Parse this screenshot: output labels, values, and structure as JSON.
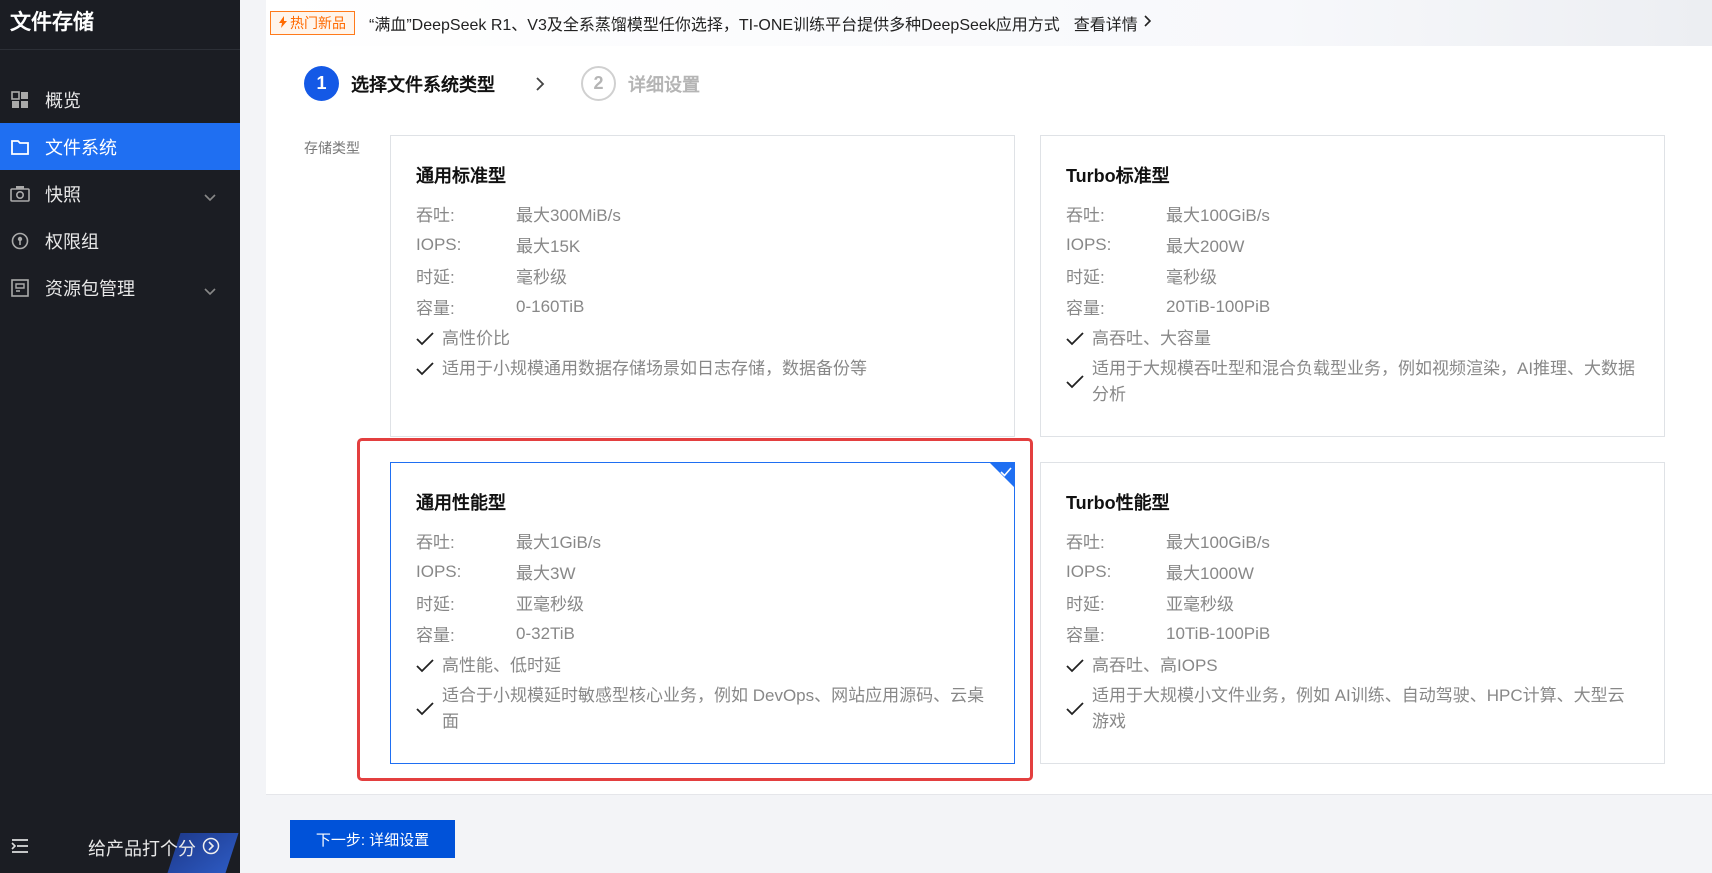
{
  "sidebar": {
    "title": "文件存储",
    "items": [
      {
        "label": "概览",
        "icon": "grid-icon"
      },
      {
        "label": "文件系统",
        "icon": "folder-icon",
        "active": true
      },
      {
        "label": "快照",
        "icon": "camera-icon",
        "expandable": true
      },
      {
        "label": "权限组",
        "icon": "permission-icon"
      },
      {
        "label": "资源包管理",
        "icon": "package-icon",
        "expandable": true
      }
    ],
    "feedback_label": "给产品打个分"
  },
  "announcement": {
    "badge": "热门新品",
    "text": "“满血”DeepSeek R1、V3及全系蒸馏模型任你选择，TI-ONE训练平台提供多种DeepSeek应用方式",
    "link": "查看详情"
  },
  "steps": [
    {
      "num": "1",
      "label": "选择文件系统类型",
      "active": true
    },
    {
      "num": "2",
      "label": "详细设置",
      "active": false
    }
  ],
  "storage_type_label": "存储类型",
  "spec_labels": {
    "throughput": "吞吐:",
    "iops": "IOPS:",
    "latency": "时延:",
    "capacity": "容量:"
  },
  "cards": [
    {
      "title": "通用标准型",
      "throughput": "最大300MiB/s",
      "iops": "最大15K",
      "latency": "毫秒级",
      "capacity": "0-160TiB",
      "features": [
        "高性价比",
        "适用于小规模通用数据存储场景如日志存储，数据备份等"
      ],
      "selected": false
    },
    {
      "title": "Turbo标准型",
      "throughput": "最大100GiB/s",
      "iops": "最大200W",
      "latency": "毫秒级",
      "capacity": "20TiB-100PiB",
      "features": [
        "高吞吐、大容量",
        "适用于大规模吞吐型和混合负载型业务，例如视频渲染，AI推理、大数据分析"
      ],
      "selected": false
    },
    {
      "title": "通用性能型",
      "throughput": "最大1GiB/s",
      "iops": "最大3W",
      "latency": "亚毫秒级",
      "capacity": "0-32TiB",
      "features": [
        "高性能、低时延",
        "适合于小规模延时敏感型核心业务，例如 DevOps、网站应用源码、云桌面"
      ],
      "selected": true
    },
    {
      "title": "Turbo性能型",
      "throughput": "最大100GiB/s",
      "iops": "最大1000W",
      "latency": "亚毫秒级",
      "capacity": "10TiB-100PiB",
      "features": [
        "高吞吐、高IOPS",
        "适用于大规模小文件业务，例如 AI训练、自动驾驶、HPC计算、大型云游戏"
      ],
      "selected": false
    }
  ],
  "next_button": "下一步: 详细设置",
  "colors": {
    "accent": "#1f6ff2",
    "primary_button": "#0052d9",
    "highlight": "#e33f3f",
    "badge": "#ff6a00"
  }
}
